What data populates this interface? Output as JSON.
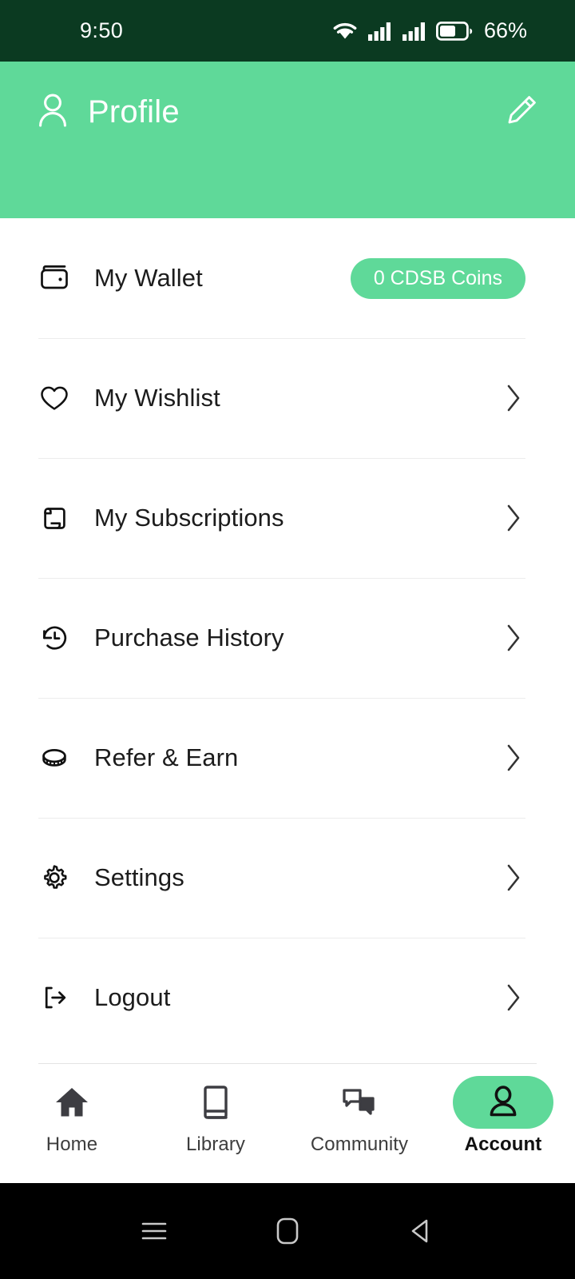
{
  "status_bar": {
    "time": "9:50",
    "battery_percent": "66%",
    "icons": [
      "wifi-icon",
      "signal-icon",
      "signal-icon",
      "battery-icon"
    ],
    "background_color": "#0b3a21"
  },
  "header": {
    "title": "Profile",
    "profile_icon": "person-icon",
    "edit_icon": "pencil-icon",
    "background_color": "#5fd999"
  },
  "menu": {
    "items": [
      {
        "label": "My Wallet",
        "icon": "wallet-icon",
        "badge": "0 CDSB Coins",
        "has_chevron": false
      },
      {
        "label": "My Wishlist",
        "icon": "heart-icon",
        "badge": null,
        "has_chevron": true
      },
      {
        "label": "My Subscriptions",
        "icon": "scroll-icon",
        "badge": null,
        "has_chevron": true
      },
      {
        "label": "Purchase History",
        "icon": "history-icon",
        "badge": null,
        "has_chevron": true
      },
      {
        "label": "Refer & Earn",
        "icon": "coin-icon",
        "badge": null,
        "has_chevron": true
      },
      {
        "label": "Settings",
        "icon": "gear-icon",
        "badge": null,
        "has_chevron": true
      },
      {
        "label": "Logout",
        "icon": "logout-icon",
        "badge": null,
        "has_chevron": true
      }
    ]
  },
  "bottom_nav": {
    "active_index": 3,
    "active_color": "#5fd999",
    "items": [
      {
        "label": "Home",
        "icon": "home-icon"
      },
      {
        "label": "Library",
        "icon": "book-icon"
      },
      {
        "label": "Community",
        "icon": "chat-bubbles-icon"
      },
      {
        "label": "Account",
        "icon": "person-icon"
      }
    ]
  },
  "system_nav": {
    "buttons": [
      {
        "name": "recents",
        "icon": "hamburger-icon"
      },
      {
        "name": "home",
        "icon": "rounded-square-icon"
      },
      {
        "name": "back",
        "icon": "triangle-left-icon"
      }
    ],
    "background_color": "#000000"
  }
}
